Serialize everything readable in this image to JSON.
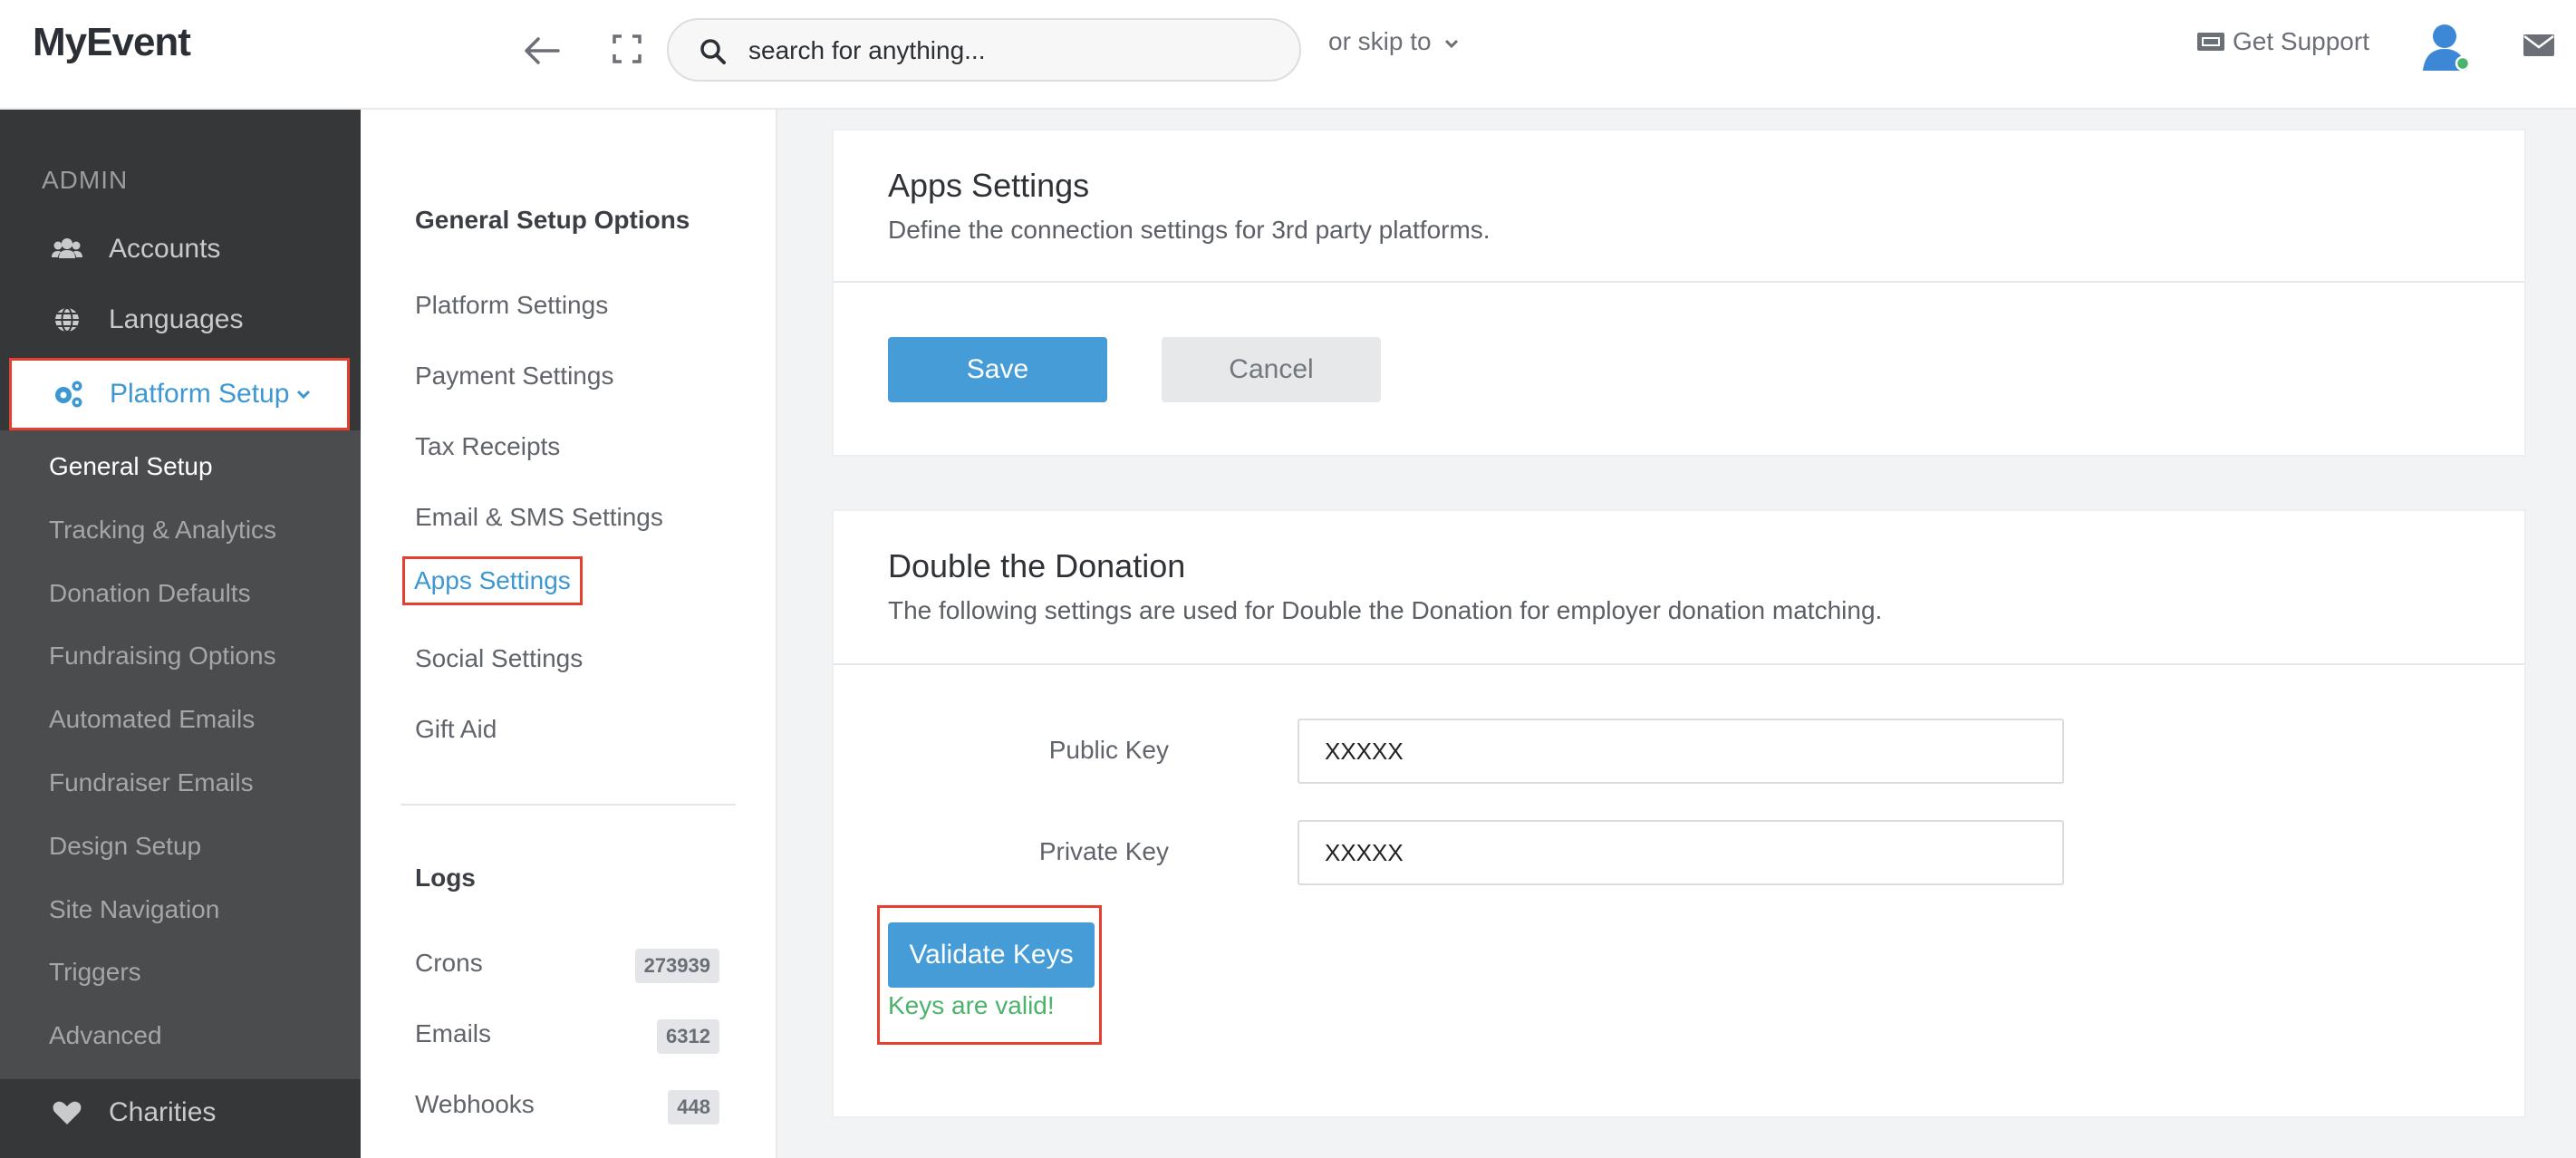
{
  "header": {
    "logo": "MyEvent",
    "search_placeholder": "search for anything...",
    "skip_label": "or skip to",
    "support_label": "Get Support"
  },
  "sidebar": {
    "heading": "ADMIN",
    "items": [
      {
        "label": "Accounts",
        "icon": "users-icon"
      },
      {
        "label": "Languages",
        "icon": "globe-icon"
      },
      {
        "label": "Platform Setup",
        "icon": "gears-icon",
        "active": true
      }
    ],
    "submenu": [
      {
        "label": "General Setup",
        "current": true
      },
      {
        "label": "Tracking & Analytics"
      },
      {
        "label": "Donation Defaults"
      },
      {
        "label": "Fundraising Options"
      },
      {
        "label": "Automated Emails"
      },
      {
        "label": "Fundraiser Emails"
      },
      {
        "label": "Design Setup"
      },
      {
        "label": "Site Navigation"
      },
      {
        "label": "Triggers"
      },
      {
        "label": "Advanced"
      }
    ],
    "bottom_item": {
      "label": "Charities",
      "icon": "heart-icon"
    }
  },
  "setup_nav": {
    "heading": "General Setup Options",
    "links": [
      {
        "label": "Platform Settings"
      },
      {
        "label": "Payment Settings"
      },
      {
        "label": "Tax Receipts"
      },
      {
        "label": "Email & SMS Settings"
      },
      {
        "label": "Apps Settings",
        "active": true
      },
      {
        "label": "Social Settings"
      },
      {
        "label": "Gift Aid"
      }
    ],
    "logs_heading": "Logs",
    "logs": [
      {
        "label": "Crons",
        "count": "273939"
      },
      {
        "label": "Emails",
        "count": "6312"
      },
      {
        "label": "Webhooks",
        "count": "448"
      }
    ]
  },
  "apps_card": {
    "title": "Apps Settings",
    "description": "Define the connection settings for 3rd party platforms.",
    "save_label": "Save",
    "cancel_label": "Cancel"
  },
  "dtd_card": {
    "title": "Double the Donation",
    "description": "The following settings are used for Double the Donation for employer donation matching.",
    "public_key_label": "Public Key",
    "public_key_value": "XXXXX",
    "private_key_label": "Private Key",
    "private_key_value": "XXXXX",
    "validate_label": "Validate Keys",
    "valid_message": "Keys are valid!"
  },
  "colors": {
    "accent": "#459cd7",
    "highlight_border": "#e5402f",
    "success": "#4cb36b",
    "sidebar_bg": "#363738"
  }
}
